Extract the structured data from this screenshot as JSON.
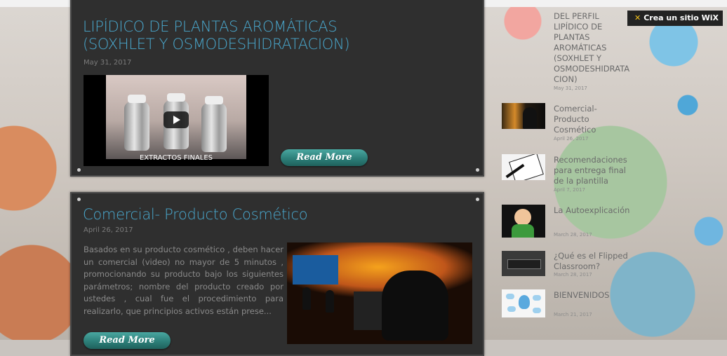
{
  "wix_badge": {
    "label": "Crea un sitio WiX"
  },
  "post1": {
    "title": "LIPÍDICO DE PLANTAS AROMÁTICAS (SOXHLET Y OSMODESHIDRATACION)",
    "date": "May 31, 2017",
    "video_caption": "EXTRACTOS FINALES",
    "read_more": "Read More"
  },
  "post2": {
    "title": "Comercial- Producto Cosmético",
    "date": "April 26, 2017",
    "excerpt": "Basados en su  producto cosmético , deben hacer un comercial (video) no mayor de 5 minutos , promocionando su producto bajo los siguientes parámetros; nombre del producto creado por ustedes , cual fue el procedimiento  para  realizarlo,  que principios activos están prese...",
    "read_more": "Read More"
  },
  "sidebar": {
    "items": [
      {
        "title": "DEL PERFIL LIPÍDICO DE PLANTAS AROMÁTICAS (SOXHLET Y OSMODESHIDRATA CION)",
        "date": "May 31, 2017"
      },
      {
        "title": "Comercial- Producto Cosmético",
        "date": "April 26, 2017"
      },
      {
        "title": "Recomendaciones para entrega final de la plantilla",
        "date": "April 7, 2017"
      },
      {
        "title": "La Autoexplicación",
        "date": "March 28, 2017"
      },
      {
        "title": "¿Qué es el Flipped Classroom?",
        "date": "March 28, 2017"
      },
      {
        "title": "BIENVENIDOS",
        "date": "March 21, 2017"
      }
    ]
  }
}
